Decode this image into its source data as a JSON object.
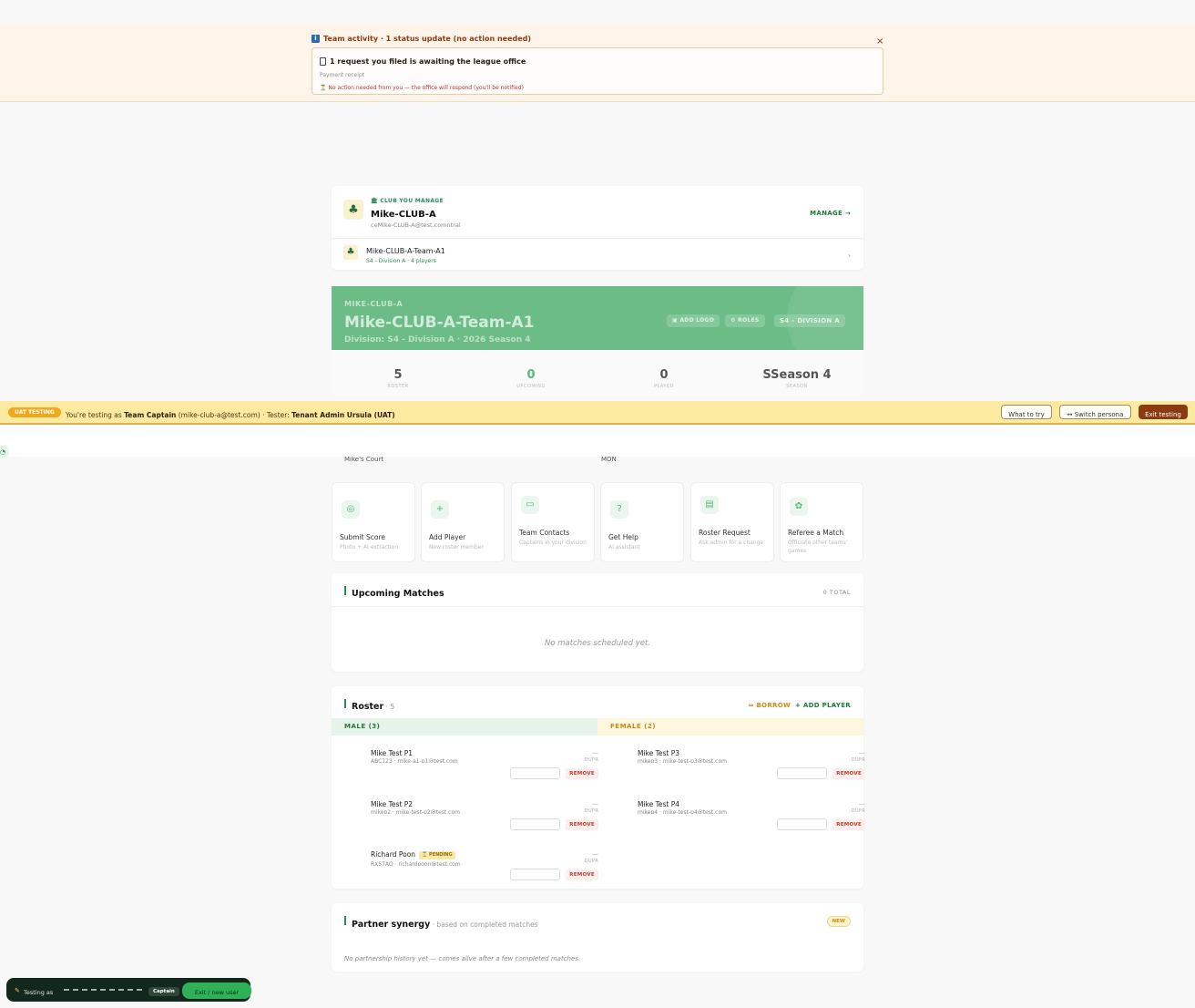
{
  "notice": {
    "title": "Team activity · 1 status update (no action needed)",
    "close": "×",
    "card_title": "1 request you filed is awaiting the league office",
    "card_sub": "Payment receipt",
    "card_note": "⏳ No action needed from you — the office will respond (you'll be notified)"
  },
  "club": {
    "kicker": "CLUB YOU MANAGE",
    "name": "Mike-CLUB-A",
    "email": "ceMike-CLUB-A@test.comntral",
    "manage": "MANAGE →",
    "team_name": "Mike-CLUB-A-Team-A1",
    "team_sub": "S4 - Division A · 4 players",
    "chevron": "›"
  },
  "hero": {
    "kicker": "MIKE-CLUB-A",
    "title": "Mike-CLUB-A-Team-A1",
    "subtitle": "Division: S4 - Division A · 2026 Season 4",
    "add_logo": "▣ ADD LOGO",
    "roles": "⚙ ROLES",
    "division": "S4 - DIVISION A"
  },
  "stats": [
    {
      "value": "5",
      "label": "ROSTER"
    },
    {
      "value": "0",
      "label": "UPCOMING"
    },
    {
      "value": "0",
      "label": "PLAYED"
    },
    {
      "value": "SSeason 4",
      "label": "SEASON"
    }
  ],
  "uat": {
    "badge": "UAT TESTING",
    "prefix": "You're testing as ",
    "persona": "Team Captain",
    "email": " (mike-club-a@test.com)",
    "tester_prefix": " · Tester: ",
    "tester": "Tenant Admin Ursula (UAT)",
    "what": "What to try",
    "switch": "↔ Switch persona",
    "exit": "Exit testing"
  },
  "peek": {
    "left": "Mike's Court",
    "right": "MON"
  },
  "actions": [
    {
      "icon": "◎",
      "title": "Submit Score",
      "sub": "Photo + AI extraction"
    },
    {
      "icon": "+",
      "title": "Add Player",
      "sub": "New roster member"
    },
    {
      "icon": "▭",
      "title": "Team Contacts",
      "sub": "Captains in your division"
    },
    {
      "icon": "?",
      "title": "Get Help",
      "sub": "AI assistant"
    },
    {
      "icon": "▤",
      "title": "Roster Request",
      "sub": "Ask admin for a change"
    },
    {
      "icon": "✿",
      "title": "Referee a Match",
      "sub": "Officiate other teams' games"
    }
  ],
  "upcoming": {
    "title": "Upcoming Matches",
    "total": "0 TOTAL",
    "empty": "No matches scheduled yet."
  },
  "roster": {
    "title": "Roster",
    "count": " · 5",
    "borrow": "⇔ BORROW",
    "add": "+ ADD PLAYER",
    "male_head": "MALE (3)",
    "female_head": "FEMALE (2)",
    "male": [
      {
        "name": "Mike Test P1",
        "sub": "ABC123 · mike-a1-p1@test.com",
        "dash": "—",
        "dupr": "DUPR",
        "remove": "REMOVE"
      },
      {
        "name": "Mike Test P2",
        "sub": "mikep2 · mike-test-p2@test.com",
        "dash": "—",
        "dupr": "DUPR",
        "remove": "REMOVE"
      },
      {
        "name": "Richard Poon",
        "pending": "⌛ PENDING",
        "sub": "RX57AO · richardpoon@test.com",
        "dash": "—",
        "dupr": "DUPR",
        "remove": "REMOVE"
      }
    ],
    "female": [
      {
        "name": "Mike Test P3",
        "sub": "mikep3 · mike-test-p3@test.com",
        "dash": "—",
        "dupr": "DUPR",
        "remove": "REMOVE"
      },
      {
        "name": "Mike Test P4",
        "sub": "mikep4 · mike-test-p4@test.com",
        "dash": "—",
        "dupr": "DUPR",
        "remove": "REMOVE"
      }
    ]
  },
  "synergy": {
    "title": "Partner synergy",
    "suffix": " · based on completed matches",
    "badge": "NEW",
    "note": "No partnership history yet — comes alive after a few completed matches."
  },
  "float": {
    "testing_as": "Testing as",
    "role": "Captain",
    "exit": "Exit / new user"
  },
  "colors": {
    "brand_green": "#2e8b57",
    "hero_green": "#6bbc86",
    "uat_yellow": "#fdeaa1",
    "exit_brown": "#8a3b12"
  }
}
